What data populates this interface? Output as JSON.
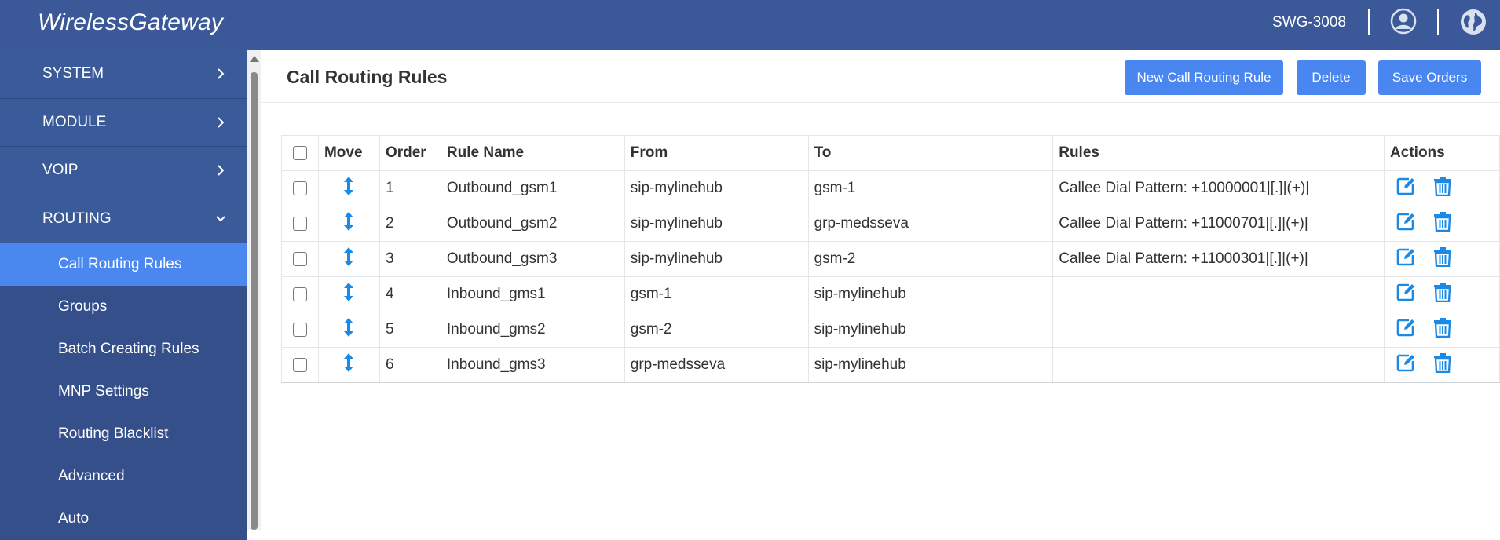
{
  "header": {
    "brand": "WirelessGateway",
    "device": "SWG-3008",
    "icons": [
      "user-icon",
      "globe-icon"
    ]
  },
  "sidebar": {
    "menus": [
      {
        "label": "SYSTEM"
      },
      {
        "label": "MODULE"
      },
      {
        "label": "VOIP"
      },
      {
        "label": "ROUTING"
      }
    ],
    "routing_items": [
      {
        "label": "Call Routing Rules",
        "active": true
      },
      {
        "label": "Groups"
      },
      {
        "label": "Batch Creating Rules"
      },
      {
        "label": "MNP Settings"
      },
      {
        "label": "Routing Blacklist"
      },
      {
        "label": "Advanced"
      },
      {
        "label": "Auto"
      }
    ]
  },
  "main": {
    "title": "Call Routing Rules",
    "buttons": {
      "new": "New Call Routing Rule",
      "delete": "Delete",
      "save": "Save Orders"
    },
    "table": {
      "headers": [
        "Move",
        "Order",
        "Rule Name",
        "From",
        "To",
        "Rules",
        "Actions"
      ],
      "rows": [
        {
          "order": "1",
          "name": "Outbound_gsm1",
          "from": "sip-mylinehub",
          "to": "gsm-1",
          "rules": "Callee Dial Pattern: +10000001|[.]|(+)|"
        },
        {
          "order": "2",
          "name": "Outbound_gsm2",
          "from": "sip-mylinehub",
          "to": "grp-medsseva",
          "rules": "Callee Dial Pattern: +11000701|[.]|(+)|"
        },
        {
          "order": "3",
          "name": "Outbound_gsm3",
          "from": "sip-mylinehub",
          "to": "gsm-2",
          "rules": "Callee Dial Pattern: +11000301|[.]|(+)|"
        },
        {
          "order": "4",
          "name": "Inbound_gms1",
          "from": "gsm-1",
          "to": "sip-mylinehub",
          "rules": ""
        },
        {
          "order": "5",
          "name": "Inbound_gms2",
          "from": "gsm-2",
          "to": "sip-mylinehub",
          "rules": ""
        },
        {
          "order": "6",
          "name": "Inbound_gms3",
          "from": "grp-medsseva",
          "to": "sip-mylinehub",
          "rules": ""
        }
      ]
    }
  },
  "colors": {
    "header_bg": "#3b5998",
    "sidebar_bg": "#3b5a99",
    "active_bg": "#4a88f0",
    "accent": "#1a8ae6"
  }
}
